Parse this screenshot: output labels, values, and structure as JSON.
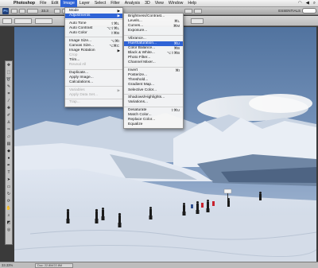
{
  "menubar": {
    "apple_glyph": "",
    "items": [
      "Photoshop",
      "File",
      "Edit",
      "Image",
      "Layer",
      "Select",
      "Filter",
      "Analysis",
      "3D",
      "View",
      "Window",
      "Help"
    ],
    "active_item": "Image"
  },
  "appbar": {
    "logo": "Ps",
    "zoom": "33.3",
    "essentials": "ESSENTIALS"
  },
  "statusbar": {
    "zoom_level": "33.33%",
    "doc_info": "Doc: 22.8M/22.8M"
  },
  "image_menu": {
    "items": [
      {
        "label": "Mode",
        "shortcut": "",
        "submenu": true,
        "disabled": false
      },
      {
        "label": "Adjustments",
        "shortcut": "",
        "submenu": true,
        "disabled": false,
        "highlighted": true
      },
      {
        "sep": true
      },
      {
        "label": "Auto Tone",
        "shortcut": "⇧⌘L",
        "disabled": false
      },
      {
        "label": "Auto Contrast",
        "shortcut": "⌥⇧⌘L",
        "disabled": false
      },
      {
        "label": "Auto Color",
        "shortcut": "⇧⌘B",
        "disabled": false
      },
      {
        "sep": true
      },
      {
        "label": "Image Size...",
        "shortcut": "⌥⌘I",
        "disabled": false
      },
      {
        "label": "Canvas Size...",
        "shortcut": "⌥⌘C",
        "disabled": false
      },
      {
        "label": "Image Rotation",
        "shortcut": "",
        "submenu": true,
        "disabled": false
      },
      {
        "label": "Crop",
        "shortcut": "",
        "disabled": true
      },
      {
        "label": "Trim...",
        "shortcut": "",
        "disabled": false
      },
      {
        "label": "Reveal All",
        "shortcut": "",
        "disabled": true
      },
      {
        "sep": true
      },
      {
        "label": "Duplicate...",
        "shortcut": "",
        "disabled": false
      },
      {
        "label": "Apply Image...",
        "shortcut": "",
        "disabled": false
      },
      {
        "label": "Calculations...",
        "shortcut": "",
        "disabled": false
      },
      {
        "sep": true
      },
      {
        "label": "Variables",
        "shortcut": "",
        "submenu": true,
        "disabled": true
      },
      {
        "label": "Apply Data Set...",
        "shortcut": "",
        "disabled": true
      },
      {
        "sep": true
      },
      {
        "label": "Trap...",
        "shortcut": "",
        "disabled": true
      }
    ]
  },
  "adjustments_menu": {
    "items": [
      {
        "label": "Brightness/Contrast...",
        "shortcut": ""
      },
      {
        "label": "Levels...",
        "shortcut": "⌘L"
      },
      {
        "label": "Curves...",
        "shortcut": "⌘M"
      },
      {
        "label": "Exposure...",
        "shortcut": ""
      },
      {
        "sep": true
      },
      {
        "label": "Vibrance...",
        "shortcut": ""
      },
      {
        "label": "Hue/Saturation...",
        "shortcut": "⌘U",
        "highlighted": true
      },
      {
        "label": "Color Balance...",
        "shortcut": "⌘B"
      },
      {
        "label": "Black & White...",
        "shortcut": "⌥⇧⌘B"
      },
      {
        "label": "Photo Filter...",
        "shortcut": ""
      },
      {
        "label": "Channel Mixer...",
        "shortcut": ""
      },
      {
        "sep": true
      },
      {
        "label": "Invert",
        "shortcut": "⌘I"
      },
      {
        "label": "Posterize...",
        "shortcut": ""
      },
      {
        "label": "Threshold...",
        "shortcut": ""
      },
      {
        "label": "Gradient Map...",
        "shortcut": ""
      },
      {
        "label": "Selective Color...",
        "shortcut": ""
      },
      {
        "sep": true
      },
      {
        "label": "Shadows/Highlights...",
        "shortcut": ""
      },
      {
        "label": "Variations...",
        "shortcut": ""
      },
      {
        "sep": true
      },
      {
        "label": "Desaturate",
        "shortcut": "⇧⌘U"
      },
      {
        "label": "Match Color...",
        "shortcut": ""
      },
      {
        "label": "Replace Color...",
        "shortcut": ""
      },
      {
        "label": "Equalize",
        "shortcut": ""
      }
    ]
  },
  "tools": [
    "move",
    "marquee",
    "lasso",
    "quick-select",
    "crop",
    "eyedropper",
    "healing",
    "brush",
    "clone-stamp",
    "history-brush",
    "eraser",
    "gradient",
    "blur",
    "dodge",
    "pen",
    "type",
    "path-select",
    "shape",
    "3d-rotate",
    "3d-orbit",
    "hand",
    "zoom",
    "fg-bg-colors",
    "quick-mask"
  ],
  "colors": {
    "menu_highlight": "#2f63d6",
    "disabled_text": "#a7a7a7",
    "sky": "#5d82ad"
  }
}
